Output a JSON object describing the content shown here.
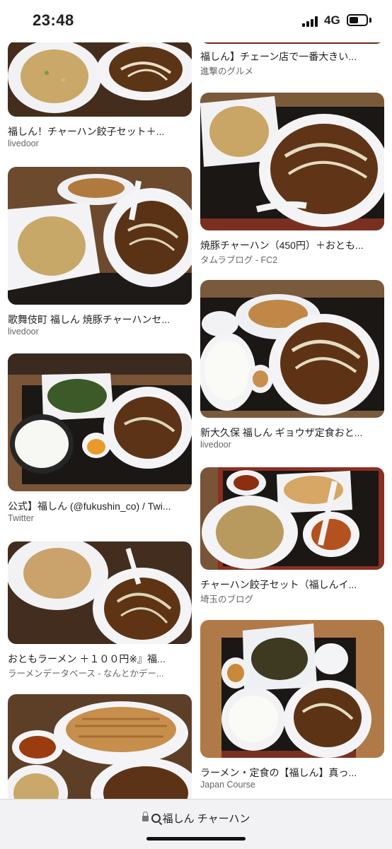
{
  "status_bar": {
    "time": "23:48",
    "network": "4G"
  },
  "results_left": [
    {
      "title": "福しん！チャーハン餃子セット＋...",
      "source": "livedoor"
    },
    {
      "title": "歌舞伎町 福しん 焼豚チャーハンセ...",
      "source": "livedoor"
    },
    {
      "title": "公式】福しん (@fukushin_co) / Twi...",
      "source": "Twitter"
    },
    {
      "title": "おともラーメン ＋１００円※』福...",
      "source": "ラーメンデータベース - なんとかデー..."
    },
    {
      "title": "",
      "source": ""
    }
  ],
  "results_right": [
    {
      "title": "福しん】チェーン店で一番大きい...",
      "source": "進撃のグルメ"
    },
    {
      "title": "焼豚チャーハン（450円）＋おとも...",
      "source": "タムラブログ - FC2"
    },
    {
      "title": "新大久保 福しん ギョウザ定食おと...",
      "source": "livedoor"
    },
    {
      "title": "チャーハン餃子セット（福しんイ...",
      "source": "埼玉のブログ"
    },
    {
      "title": "ラーメン・定食の【福しん】真っ...",
      "source": "Japan Course"
    }
  ],
  "address_bar": {
    "query": "福しん チャーハン"
  }
}
